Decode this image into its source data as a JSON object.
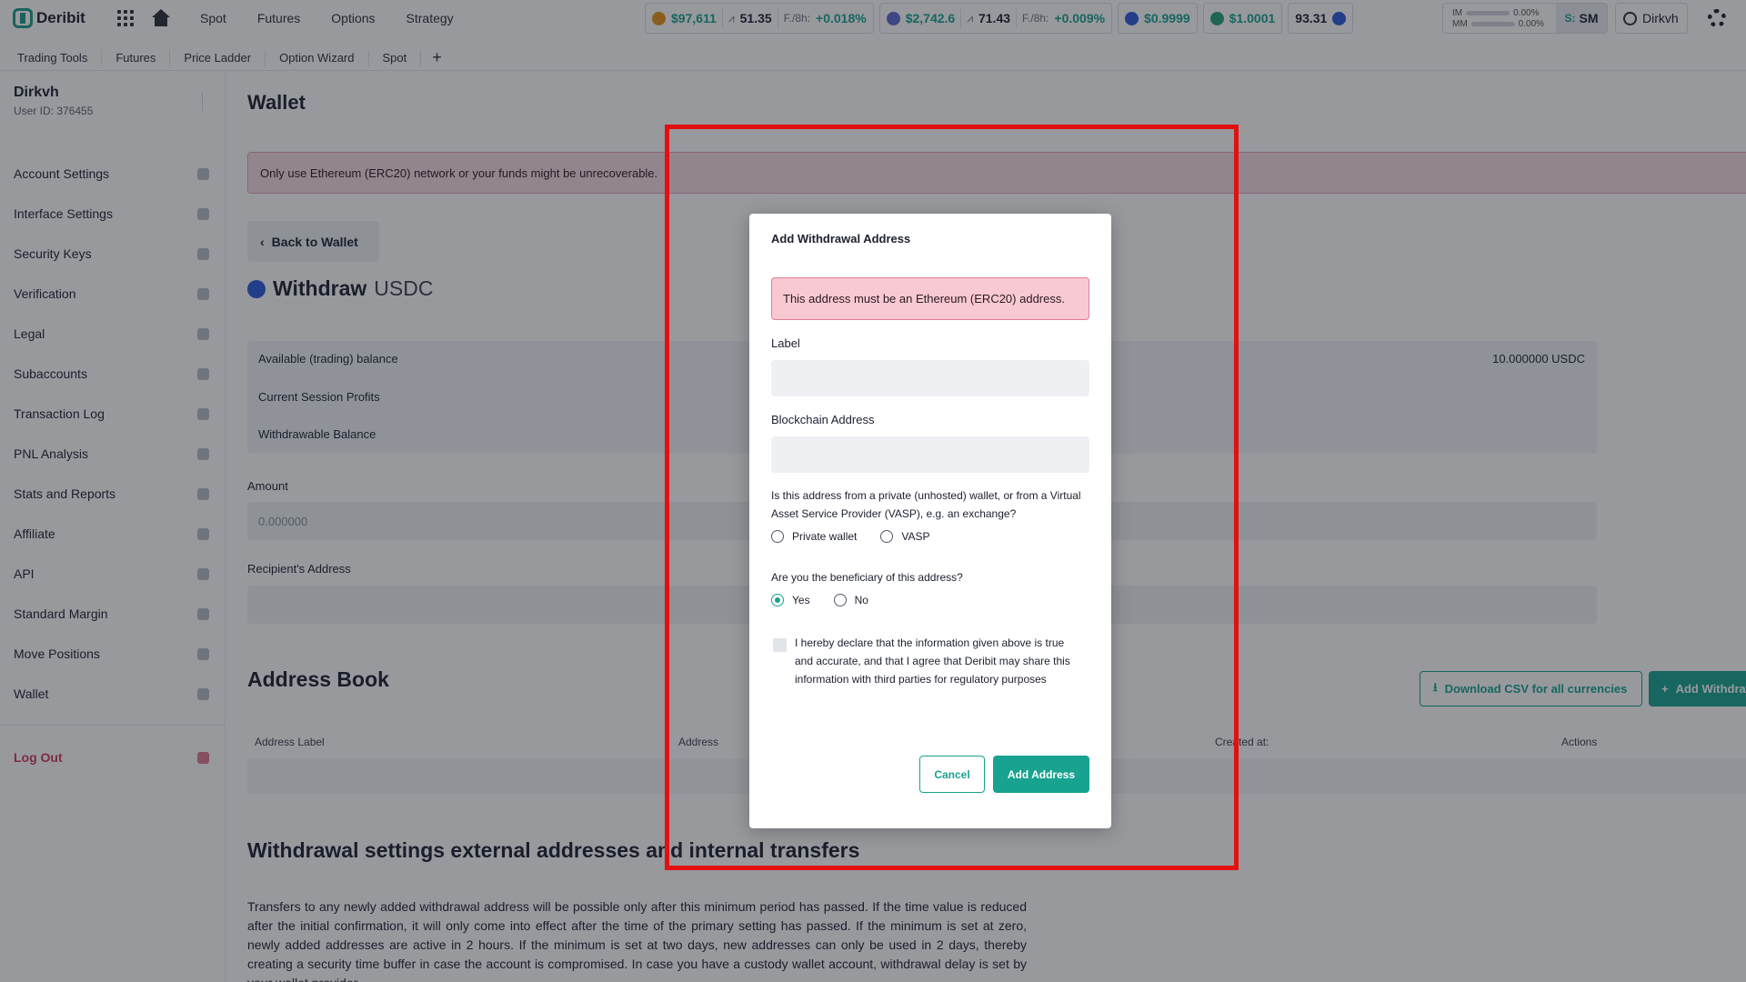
{
  "app": {
    "brand": "Deribit"
  },
  "topnav": {
    "links": [
      "Spot",
      "Futures",
      "Options",
      "Strategy"
    ],
    "tickers": [
      {
        "coin_color": "#e7931a",
        "price": "$97,611",
        "vol": "51.35",
        "funding_label": "F./8h:",
        "funding": "+0.018%"
      },
      {
        "coin_color": "#5b6bd6",
        "price": "$2,742.6",
        "vol": "71.43",
        "funding_label": "F./8h:",
        "funding": "+0.009%"
      },
      {
        "coin_color": "#2a5ada",
        "price": "$0.9999"
      },
      {
        "coin_color": "#26a17b",
        "price": "$1.0001"
      },
      {
        "coin_color": "#2a5ada",
        "price": "93.31"
      }
    ],
    "margin": {
      "im_label": "IM",
      "im_value": "0.00%",
      "mm_label": "MM",
      "mm_value": "0.00%",
      "mode_prefix": "S:",
      "mode": "SM"
    },
    "user": "Dirkvh"
  },
  "tabs": [
    "Trading Tools",
    "Futures",
    "Price Ladder",
    "Option Wizard",
    "Spot",
    "+"
  ],
  "sidebar": {
    "name": "Dirkvh",
    "user_id": "User ID: 376455",
    "items": [
      "Account Settings",
      "Interface Settings",
      "Security Keys",
      "Verification",
      "Legal",
      "Subaccounts",
      "Transaction Log",
      "PNL Analysis",
      "Stats and Reports",
      "Affiliate",
      "API",
      "Standard Margin",
      "Move Positions",
      "Wallet"
    ],
    "logout": "Log Out"
  },
  "main": {
    "title": "Wallet",
    "banner": "Only use Ethereum (ERC20) network or your funds might be unrecoverable.",
    "back": "Back to Wallet",
    "withdraw": "Withdraw",
    "currency": "USDC",
    "balances": [
      {
        "label": "Available (trading) balance",
        "value": "10.000000 USDC"
      },
      {
        "label": "Current Session Profits"
      },
      {
        "label": "Withdrawable Balance"
      }
    ],
    "amount_label": "Amount",
    "amount_placeholder": "0.000000",
    "recipient_label": "Recipient's Address",
    "address_book": {
      "title": "Address Book",
      "csv_button": "Download CSV for all currencies",
      "add_button": "Add Withdrawal Address",
      "columns": [
        "Address Label",
        "Address",
        "Created at:",
        "Actions"
      ]
    },
    "withdrawal_settings": {
      "title": "Withdrawal settings external addresses and internal transfers",
      "text": "Transfers to any newly added withdrawal address will be possible only after this minimum period has passed. If the time value is reduced after the initial confirmation, it will only come into effect after the time of the primary setting has passed. If the minimum is set at zero, newly added addresses are active in 2 hours. If the minimum is set at two days, new addresses can only be used in 2 days, thereby creating a security time buffer in case the account is compromised. In case you have a custody wallet account, withdrawal delay is set by your wallet provider."
    }
  },
  "modal": {
    "title": "Add Withdrawal Address",
    "alert": "This address must be an Ethereum (ERC20) address.",
    "label_field": "Label",
    "address_field": "Blockchain Address",
    "wallet_question": "Is this address from a private (unhosted) wallet, or from a Virtual Asset Service Provider (VASP), e.g. an exchange?",
    "wallet_options": [
      "Private wallet",
      "VASP"
    ],
    "beneficiary_question": "Are you the beneficiary of this address?",
    "beneficiary_options": [
      "Yes",
      "No"
    ],
    "beneficiary_selected": "Yes",
    "declaration": "I hereby declare that the information given above is true and accurate, and that I agree that Deribit may share this information with third parties for regulatory purposes",
    "cancel": "Cancel",
    "submit": "Add Address"
  },
  "highlight_color": "#e31010"
}
